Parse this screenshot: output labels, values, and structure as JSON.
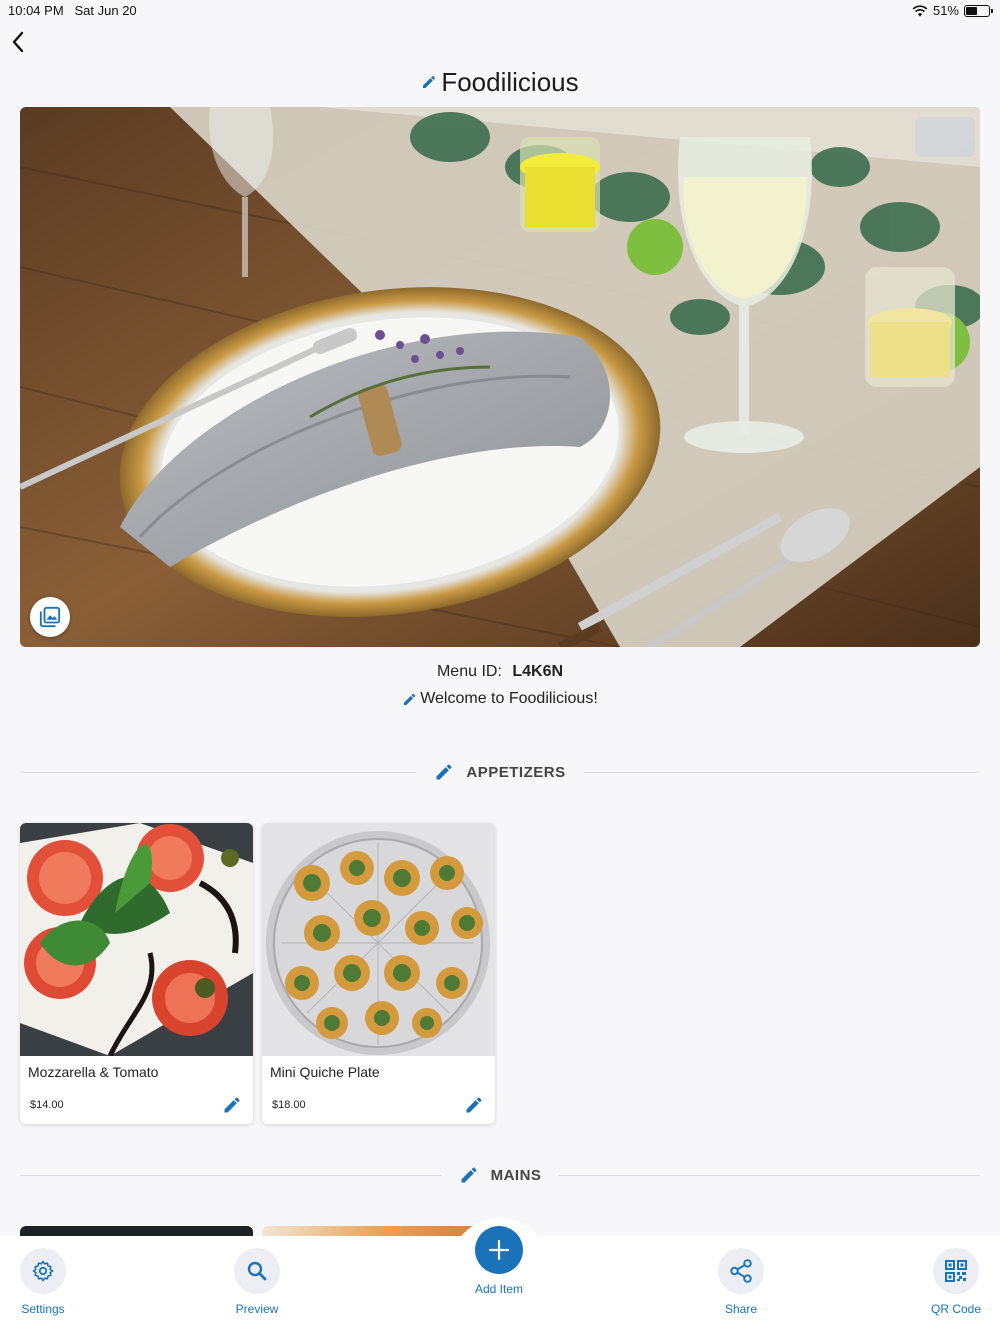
{
  "status_bar": {
    "time": "10:04 PM",
    "date": "Sat Jun 20",
    "battery_percent": "51%",
    "battery_level": 0.51,
    "wifi_icon": "wifi-icon"
  },
  "header": {
    "back_icon": "chevron-left-icon",
    "title": "Foodilicious",
    "edit_icon": "pencil-icon"
  },
  "hero": {
    "change_photo_icon": "photo-library-icon"
  },
  "menu_info": {
    "id_label": "Menu ID:",
    "id_value": "L4K6N",
    "welcome": "Welcome to Foodilicious!"
  },
  "sections": [
    {
      "title": "APPETIZERS",
      "items": [
        {
          "name": "Mozzarella & Tomato",
          "price": "$14.00"
        },
        {
          "name": "Mini Quiche Plate",
          "price": "$18.00"
        }
      ]
    },
    {
      "title": "MAINS",
      "items": []
    }
  ],
  "tab_bar": {
    "settings": {
      "label": "Settings",
      "icon": "gear-icon"
    },
    "preview": {
      "label": "Preview",
      "icon": "search-icon"
    },
    "add_item": {
      "label": "Add Item",
      "icon": "plus-icon"
    },
    "share": {
      "label": "Share",
      "icon": "share-icon"
    },
    "qr_code": {
      "label": "QR Code",
      "icon": "qr-code-icon"
    }
  },
  "colors": {
    "accent": "#1a73b9",
    "background": "#f7f7fa",
    "divider": "#dadde3"
  }
}
